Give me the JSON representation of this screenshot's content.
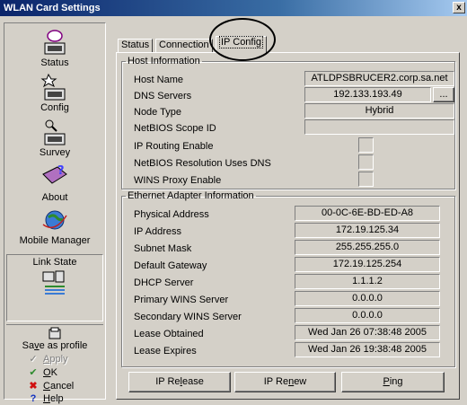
{
  "window": {
    "title": "WLAN Card Settings",
    "close_label": "x"
  },
  "sidebar": {
    "items": [
      {
        "label": "Status",
        "icon": "status-icon"
      },
      {
        "label": "Config",
        "icon": "config-icon"
      },
      {
        "label": "Survey",
        "icon": "survey-icon"
      },
      {
        "label": "About",
        "icon": "about-icon"
      },
      {
        "label": "Mobile Manager",
        "icon": "mobile-manager-icon"
      }
    ],
    "link_state": {
      "label": "Link State",
      "icon": "link-state-icon"
    },
    "actions": {
      "save_pre": "Sa",
      "save_ul": "v",
      "save_post": "e as profile",
      "apply_ul": "A",
      "apply_post": "pply",
      "ok_ul": "O",
      "ok_post": "K",
      "cancel_ul": "C",
      "cancel_post": "ancel",
      "help_ul": "H",
      "help_post": "elp"
    }
  },
  "tabs": [
    {
      "label": "Status"
    },
    {
      "label": "Connection"
    },
    {
      "label": "IP Config"
    }
  ],
  "host": {
    "legend": "Host Information",
    "rows": [
      {
        "label": "Host Name",
        "value": "ATLDPSBRUCER2.corp.sa.net"
      },
      {
        "label": "DNS Servers",
        "value": "192.133.193.49",
        "button": "..."
      },
      {
        "label": "Node Type",
        "value": "Hybrid"
      },
      {
        "label": "NetBIOS Scope ID",
        "value": ""
      },
      {
        "label": "IP Routing Enable"
      },
      {
        "label": "NetBIOS Resolution Uses DNS"
      },
      {
        "label": "WINS Proxy Enable"
      }
    ]
  },
  "ethernet": {
    "legend": "Ethernet Adapter Information",
    "rows": [
      {
        "label": "Physical Address",
        "value": "00-0C-6E-BD-ED-A8"
      },
      {
        "label": "IP Address",
        "value": "172.19.125.34"
      },
      {
        "label": "Subnet Mask",
        "value": "255.255.255.0"
      },
      {
        "label": "Default Gateway",
        "value": "172.19.125.254"
      },
      {
        "label": "DHCP Server",
        "value": "1.1.1.2"
      },
      {
        "label": "Primary WINS Server",
        "value": "0.0.0.0"
      },
      {
        "label": "Secondary WINS Server",
        "value": "0.0.0.0"
      },
      {
        "label": "Lease Obtained",
        "value": "Wed Jan 26 07:38:48 2005"
      },
      {
        "label": "Lease Expires",
        "value": "Wed Jan 26 19:38:48 2005"
      }
    ]
  },
  "buttons": {
    "release_pre": "IP Re",
    "release_ul": "l",
    "release_post": "ease",
    "renew_pre": "IP Re",
    "renew_ul": "n",
    "renew_post": "ew",
    "ping_ul": "P",
    "ping_post": "ing"
  }
}
